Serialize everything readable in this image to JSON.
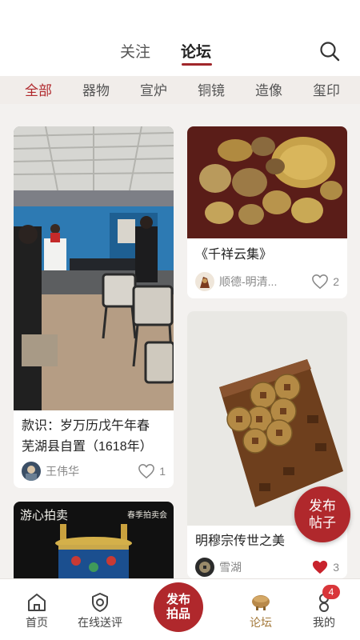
{
  "header": {
    "tabs": [
      "关注",
      "论坛"
    ],
    "active_tab": "论坛",
    "search_icon": "search-icon"
  },
  "categories": {
    "items": [
      "全部",
      "器物",
      "宣炉",
      "铜镜",
      "造像",
      "玺印"
    ],
    "active": "全部"
  },
  "posts": [
    {
      "title_line1": "款识：岁万历戊午年春",
      "title_line2": "芜湖县自置（1618年）",
      "author": "王伟华",
      "likes": "1",
      "liked": false
    },
    {
      "title": "《千祥云集》",
      "author": "顺德-明清...",
      "likes": "2",
      "liked": false
    },
    {
      "title": "明穆宗传世之美",
      "author": "雪湖",
      "likes": "3",
      "liked": true
    },
    {
      "overlay_left": "游心拍卖",
      "overlay_right": "春季拍卖会"
    }
  ],
  "fab": {
    "line1": "发布",
    "line2": "帖子"
  },
  "bottom_nav": {
    "items": [
      {
        "label": "首页",
        "icon": "home-icon"
      },
      {
        "label": "在线送评",
        "icon": "shield-check-icon"
      },
      {
        "label": "论坛",
        "icon": "forum-vessel-icon"
      },
      {
        "label": "我的",
        "icon": "user-icon"
      }
    ],
    "active": "论坛",
    "center": {
      "line1": "发布",
      "line2": "拍品"
    },
    "badge": "4"
  },
  "colors": {
    "accent": "#b0282c",
    "nav_active": "#a47a3c",
    "like_red": "#c8232c"
  }
}
